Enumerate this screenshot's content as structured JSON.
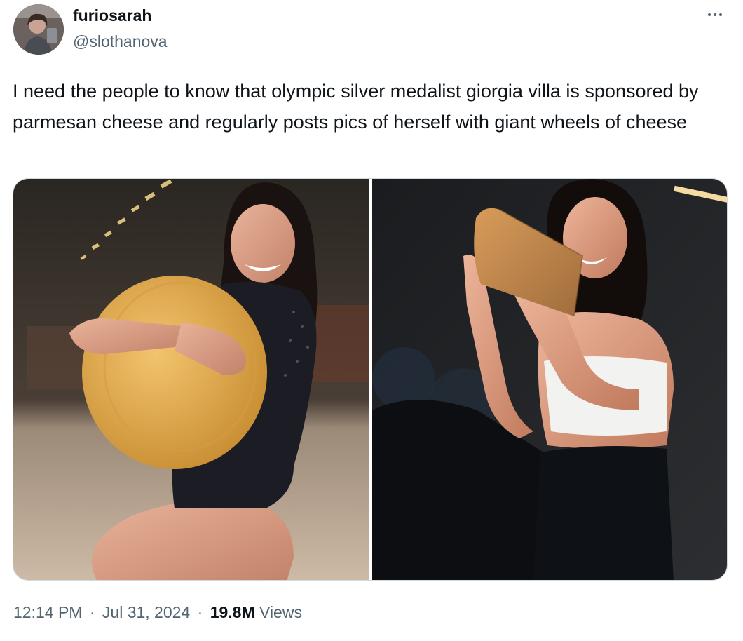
{
  "author": {
    "display_name": "furiosarah",
    "handle": "@slothanova",
    "avatar_icon": "user-avatar-photo"
  },
  "more_icon": "more-options-icon",
  "tweet": {
    "text": "I need the people to know that olympic silver medalist giorgia villa is sponsored by parmesan cheese and regularly posts pics of herself with giant wheels of cheese"
  },
  "media": [
    {
      "kind": "photo",
      "subject": "gymnast-hugging-cheese-wheel"
    },
    {
      "kind": "photo",
      "subject": "woman-holding-cheese-wedge"
    }
  ],
  "meta": {
    "time": "12:14 PM",
    "separator": "·",
    "date": "Jul 31, 2024",
    "views_count": "19.8M",
    "views_label": "Views"
  },
  "colors": {
    "text_primary": "#0f1419",
    "text_secondary": "#536471",
    "border": "#cfd9de"
  }
}
